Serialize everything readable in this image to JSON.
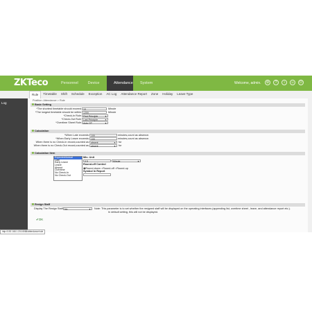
{
  "header": {
    "logo_main": "ZKTeco",
    "logo_sub": "eco",
    "welcome": "Welcome, admin.",
    "nav": [
      "Personnel",
      "Device",
      "Attendance",
      "System"
    ],
    "active_nav_index": 2,
    "icons": [
      "gear-icon",
      "help-icon",
      "info-icon",
      "user-icon",
      "logout-icon"
    ],
    "accent_color": "#7fb843"
  },
  "tabs": [
    "Rule",
    "Timetable",
    "Shift",
    "Schedule",
    "Exception",
    "AC Log",
    "Attendance Report",
    "Zone",
    "Holiday",
    "Leave Type"
  ],
  "active_tab_index": 0,
  "sidebar": {
    "items": [
      {
        "label": "Log"
      }
    ]
  },
  "breadcrumb": "Position: Attendance > Rule",
  "sections": {
    "basic": "Basic Setting",
    "calculation": "Calculation",
    "calc_item": "Calculation Item",
    "resign": "Resign Staff"
  },
  "basic": {
    "shortest_label": "*The shortest timetable should exceed",
    "shortest_value": "10",
    "shortest_unit": "Minute",
    "longest_label": "*The longest timetable should be within",
    "longest_value": "1200",
    "longest_unit": "Minute",
    "checkin_label": "*Check-In Rule",
    "checkin_value": "First Principle",
    "checkout_label": "*Check-Out Rule",
    "checkout_value": "Last Principle",
    "overtime_label": "*Overtime Sheet Rule",
    "overtime_value": "Auto OT"
  },
  "calc": {
    "late_label": "*When Late exceeds",
    "late_value": "100",
    "late_suffix": "minutes,count as absence.",
    "early_label": "*When Early Leave exceeds",
    "early_value": "100",
    "early_suffix": "minutes,count as absence.",
    "nocheckin_label": "When there is no Check-In record,counted as",
    "nocheckin_value": "absent",
    "nocheckin_suffix": "for",
    "nocheckout_label": "When there is no Check-Out record,counted as",
    "nocheckout_value": "absent",
    "nocheckout_suffix": "for"
  },
  "calc_items": {
    "list": [
      "Expected/Actual",
      "Late",
      "Early Leave",
      "Leave",
      "Absent",
      "Overtime",
      "No Check-In",
      "No Check-Out"
    ],
    "selected_index": 0,
    "min_unit_label": "Min. Unit",
    "min_unit_value": "0.5",
    "min_unit_select": "Minute",
    "roundoff_label": "Round-off Control",
    "round_options": [
      "Round-down",
      "Round-off",
      "Round-up"
    ],
    "round_selected": 0,
    "symbol_label": "Symbol In Report",
    "symbol_value": ""
  },
  "resign": {
    "label": "Display The Resign Staff",
    "value": "No",
    "note1": "Note: This parameter is to set whether the resigned staff will be displayed on the operating interfaces (appending list, overtime sheet , leave, and attendance report etc.).",
    "note2": "In default setting, this will not be displayed."
  },
  "ok_label": "OK",
  "status_url": "http://192.168.1.201:8088/attendance/rule"
}
